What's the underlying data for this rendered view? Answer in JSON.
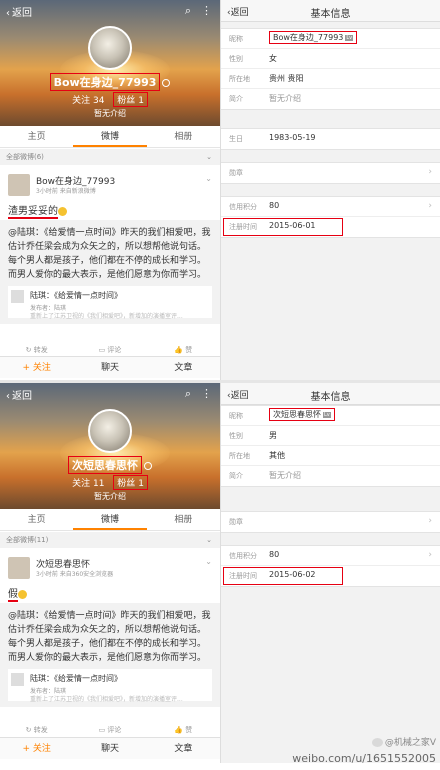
{
  "top": {
    "profile": {
      "back_label": "返回",
      "username": "Bow在身边_77993",
      "following_label": "关注",
      "following_count": "34",
      "followers_label": "粉丝",
      "followers_count": "1",
      "intro": "暂无介绍",
      "tabs": [
        "主页",
        "微博",
        "相册"
      ],
      "all_weibo": "全部微博(6)",
      "post": {
        "author": "Bow在身边_77993",
        "meta": "3小时前 来自新浪微博",
        "text": "渣男妥妥的",
        "repost_head": "@陆琪：《给爱情一点时间》昨天的我们相爱吧，我估计乔任梁会成为众矢之的，所以想帮他说句话。每个男人都是孩子，他们都在不停的成长和学习。而男人爱你的最大表示，是他们愿意为你而学习。",
        "quote_title": "陆琪：《给爱情一点时间》",
        "quote_sub": "发布者：陆琪",
        "quote_sub2": "重新上了江苏卫视的《我们相爱吧》，新增加的演播室评..."
      },
      "actions": [
        "转发",
        "评论",
        "赞"
      ],
      "bottom": [
        "+ 关注",
        "聊天",
        "文章"
      ]
    },
    "info": {
      "back_label": "返回",
      "title": "基本信息",
      "rows": [
        {
          "label": "昵称",
          "value": "Bow在身边_77993"
        },
        {
          "label": "性别",
          "value": "女"
        },
        {
          "label": "所在地",
          "value": "贵州 贵阳"
        },
        {
          "label": "简介",
          "value": "暂无介绍"
        }
      ],
      "birthday_label": "生日",
      "birthday": "1983-05-19",
      "level_label": "勋章",
      "credit_label": "信用积分",
      "credit": "80",
      "reg_label": "注册时间",
      "reg_date": "2015-06-01"
    }
  },
  "bottom": {
    "profile": {
      "back_label": "返回",
      "username": "次短思春思怀",
      "following_label": "关注",
      "following_count": "11",
      "followers_label": "粉丝",
      "followers_count": "1",
      "intro": "暂无介绍",
      "tabs": [
        "主页",
        "微博",
        "相册"
      ],
      "all_weibo": "全部微博(11)",
      "post": {
        "author": "次短思春思怀",
        "meta": "3小时前 来自360安全浏览器",
        "text": "假",
        "repost_head": "@陆琪：《给爱情一点时间》昨天的我们相爱吧，我估计乔任梁会成为众矢之的，所以想帮他说句话。每个男人都是孩子，他们都在不停的成长和学习。而男人爱你的最大表示，是他们愿意为你而学习。",
        "quote_title": "陆琪：《给爱情一点时间》",
        "quote_sub": "发布者：陆琪",
        "quote_sub2": "重新上了江苏卫视的《我们相爱吧》，新增加的演播室评..."
      },
      "actions": [
        "转发",
        "评论",
        "赞"
      ],
      "bottom": [
        "+ 关注",
        "聊天",
        "文章"
      ]
    },
    "info": {
      "back_label": "返回",
      "title": "基本信息",
      "rows": [
        {
          "label": "昵称",
          "value": "次短思春思怀"
        },
        {
          "label": "性别",
          "value": "男"
        },
        {
          "label": "所在地",
          "value": "其他"
        },
        {
          "label": "简介",
          "value": "暂无介绍"
        }
      ],
      "level_label": "勋章",
      "credit_label": "信用积分",
      "credit": "80",
      "reg_label": "注册时间",
      "reg_date": "2015-06-02"
    }
  },
  "watermark": {
    "brand": "@机械之家V",
    "url": "weibo.com/u/1651552005"
  },
  "colors": {
    "accent": "#ff8200",
    "highlight": "#e60012",
    "link": "#3b6db1"
  }
}
